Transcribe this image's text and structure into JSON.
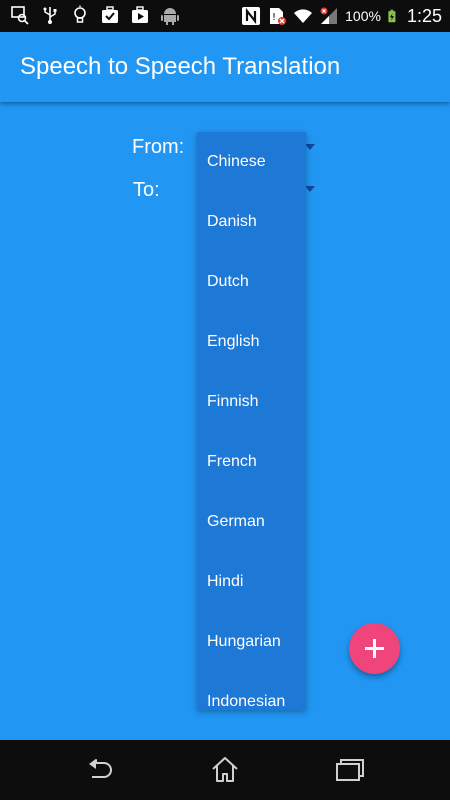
{
  "status_bar": {
    "battery_percent": "100%",
    "time": "1:25",
    "icons": [
      "search-photo-icon",
      "usb-icon",
      "lightbulb-icon",
      "briefcase-check-icon",
      "play-store-icon",
      "android-icon",
      "nfc-icon",
      "sim-error-icon",
      "wifi-icon",
      "signal-icon",
      "battery-charging-icon"
    ]
  },
  "app_bar": {
    "title": "Speech to Speech Translation"
  },
  "form": {
    "from_label": "From:",
    "to_label": "To:"
  },
  "dropdown": {
    "items": [
      {
        "label": "Chinese"
      },
      {
        "label": "Danish"
      },
      {
        "label": "Dutch"
      },
      {
        "label": "English"
      },
      {
        "label": "Finnish"
      },
      {
        "label": "French"
      },
      {
        "label": "German"
      },
      {
        "label": "Hindi"
      },
      {
        "label": "Hungarian"
      },
      {
        "label": "Indonesian"
      }
    ]
  },
  "fab": {
    "icon": "plus-icon",
    "color": "#f0457a"
  },
  "nav_bar": {
    "icons": [
      "back-icon",
      "home-icon",
      "recent-apps-icon"
    ]
  },
  "colors": {
    "primary": "#2196f3",
    "dropdown_bg": "#1e78d6",
    "accent": "#f0457a"
  }
}
